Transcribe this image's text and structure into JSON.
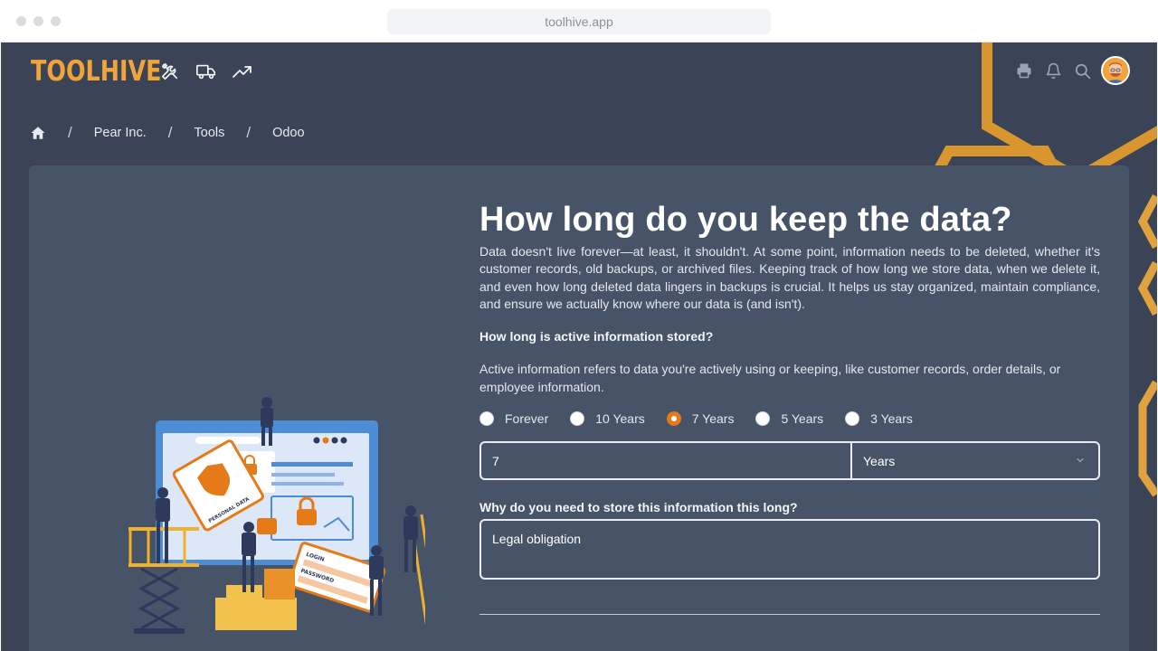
{
  "browser": {
    "url": "toolhive.app"
  },
  "header": {
    "logo": "TOOLHIVE",
    "nav_icons": [
      "tools-icon",
      "truck-icon",
      "trending-icon"
    ],
    "right_icons": [
      "printer-icon",
      "bell-icon",
      "search-icon"
    ]
  },
  "breadcrumb": {
    "items": [
      "Pear Inc.",
      "Tools",
      "Odoo"
    ]
  },
  "main": {
    "title": "How long do you keep the data?",
    "intro": "Data doesn't live forever—at least, it shouldn't. At some point, information needs to be deleted, whether it's customer records, old backups, or archived files. Keeping track of how long we store data, when we delete it, and even how long deleted data lingers in backups is crucial. It helps us stay organized, maintain compliance, and ensure we actually know where our data is (and isn't).",
    "question": "How long is active information stored?",
    "question_desc": "Active information refers to data you're actively using or keeping, like customer records, order details, or employee information.",
    "options": [
      "Forever",
      "10 Years",
      "7 Years",
      "5 Years",
      "3 Years"
    ],
    "selected_option": "7 Years",
    "duration_value": "7",
    "duration_unit": "Years",
    "why_label": "Why do you need to store this information this long?",
    "why_value": "Legal obligation"
  },
  "colors": {
    "accent": "#e77a18",
    "brand": "#f0a43a",
    "background": "#3a4456",
    "card": "#475467"
  },
  "illustration": {
    "card_label": "PERSONAL DATA",
    "login_label": "LOGIN",
    "password_label": "PASSWORD"
  }
}
